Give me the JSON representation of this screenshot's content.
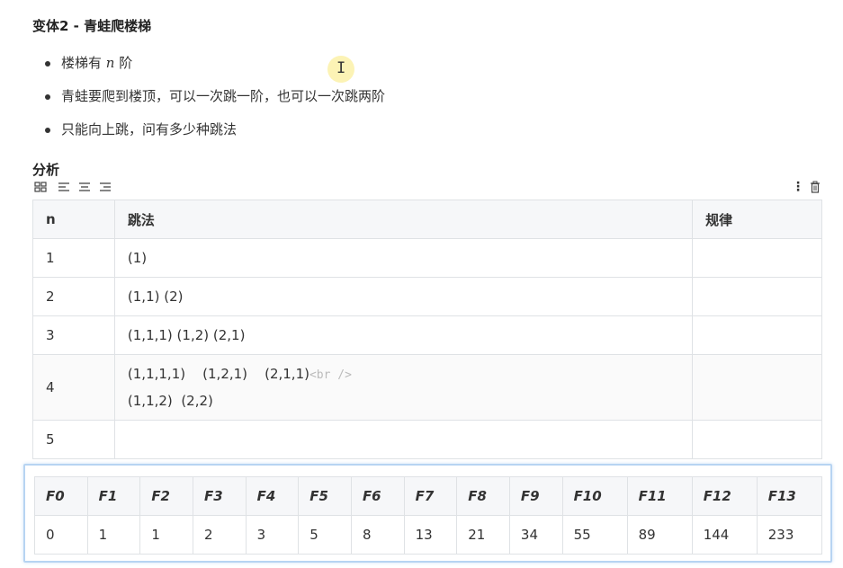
{
  "title": "变体2 - 青蛙爬楼梯",
  "bullets": {
    "b1_prefix": "楼梯有 ",
    "b1_var": "n",
    "b1_suffix": " 阶",
    "b2": "青蛙要爬到楼顶，可以一次跳一阶，也可以一次跳两阶",
    "b3": "只能向上跳，问有多少种跳法"
  },
  "section_heading": "分析",
  "toolbar": {
    "icons": [
      "grid-icon",
      "align-left-icon",
      "align-center-icon",
      "align-right-icon",
      "more-vertical-icon",
      "trash-icon"
    ],
    "more_glyph": "⋮"
  },
  "analysis_table": {
    "headers": [
      "n",
      "跳法",
      "规律"
    ],
    "rows": [
      {
        "n": "1",
        "ways": "(1)",
        "pattern": ""
      },
      {
        "n": "2",
        "ways": "(1,1)  (2)",
        "pattern": ""
      },
      {
        "n": "3",
        "ways": "(1,1,1)  (1,2)  (2,1)",
        "pattern": ""
      },
      {
        "n": "4",
        "ways_line1": "(1,1,1,1)    (1,2,1)    (2,1,1)",
        "ways_br": "<br />",
        "ways_line2": "(1,1,2)  (2,2)",
        "pattern": ""
      },
      {
        "n": "5",
        "ways": "",
        "pattern": ""
      }
    ]
  },
  "fib_table": {
    "headers": [
      "F0",
      "F1",
      "F2",
      "F3",
      "F4",
      "F5",
      "F6",
      "F7",
      "F8",
      "F9",
      "F10",
      "F11",
      "F12",
      "F13"
    ],
    "values": [
      "0",
      "1",
      "1",
      "2",
      "3",
      "5",
      "8",
      "13",
      "21",
      "34",
      "55",
      "89",
      "144",
      "233"
    ]
  },
  "colors": {
    "highlight_cursor": "#fbf1a8",
    "selection_border": "#b7d4f2",
    "table_border": "#dfe2e5",
    "header_bg": "#f6f7f9"
  }
}
